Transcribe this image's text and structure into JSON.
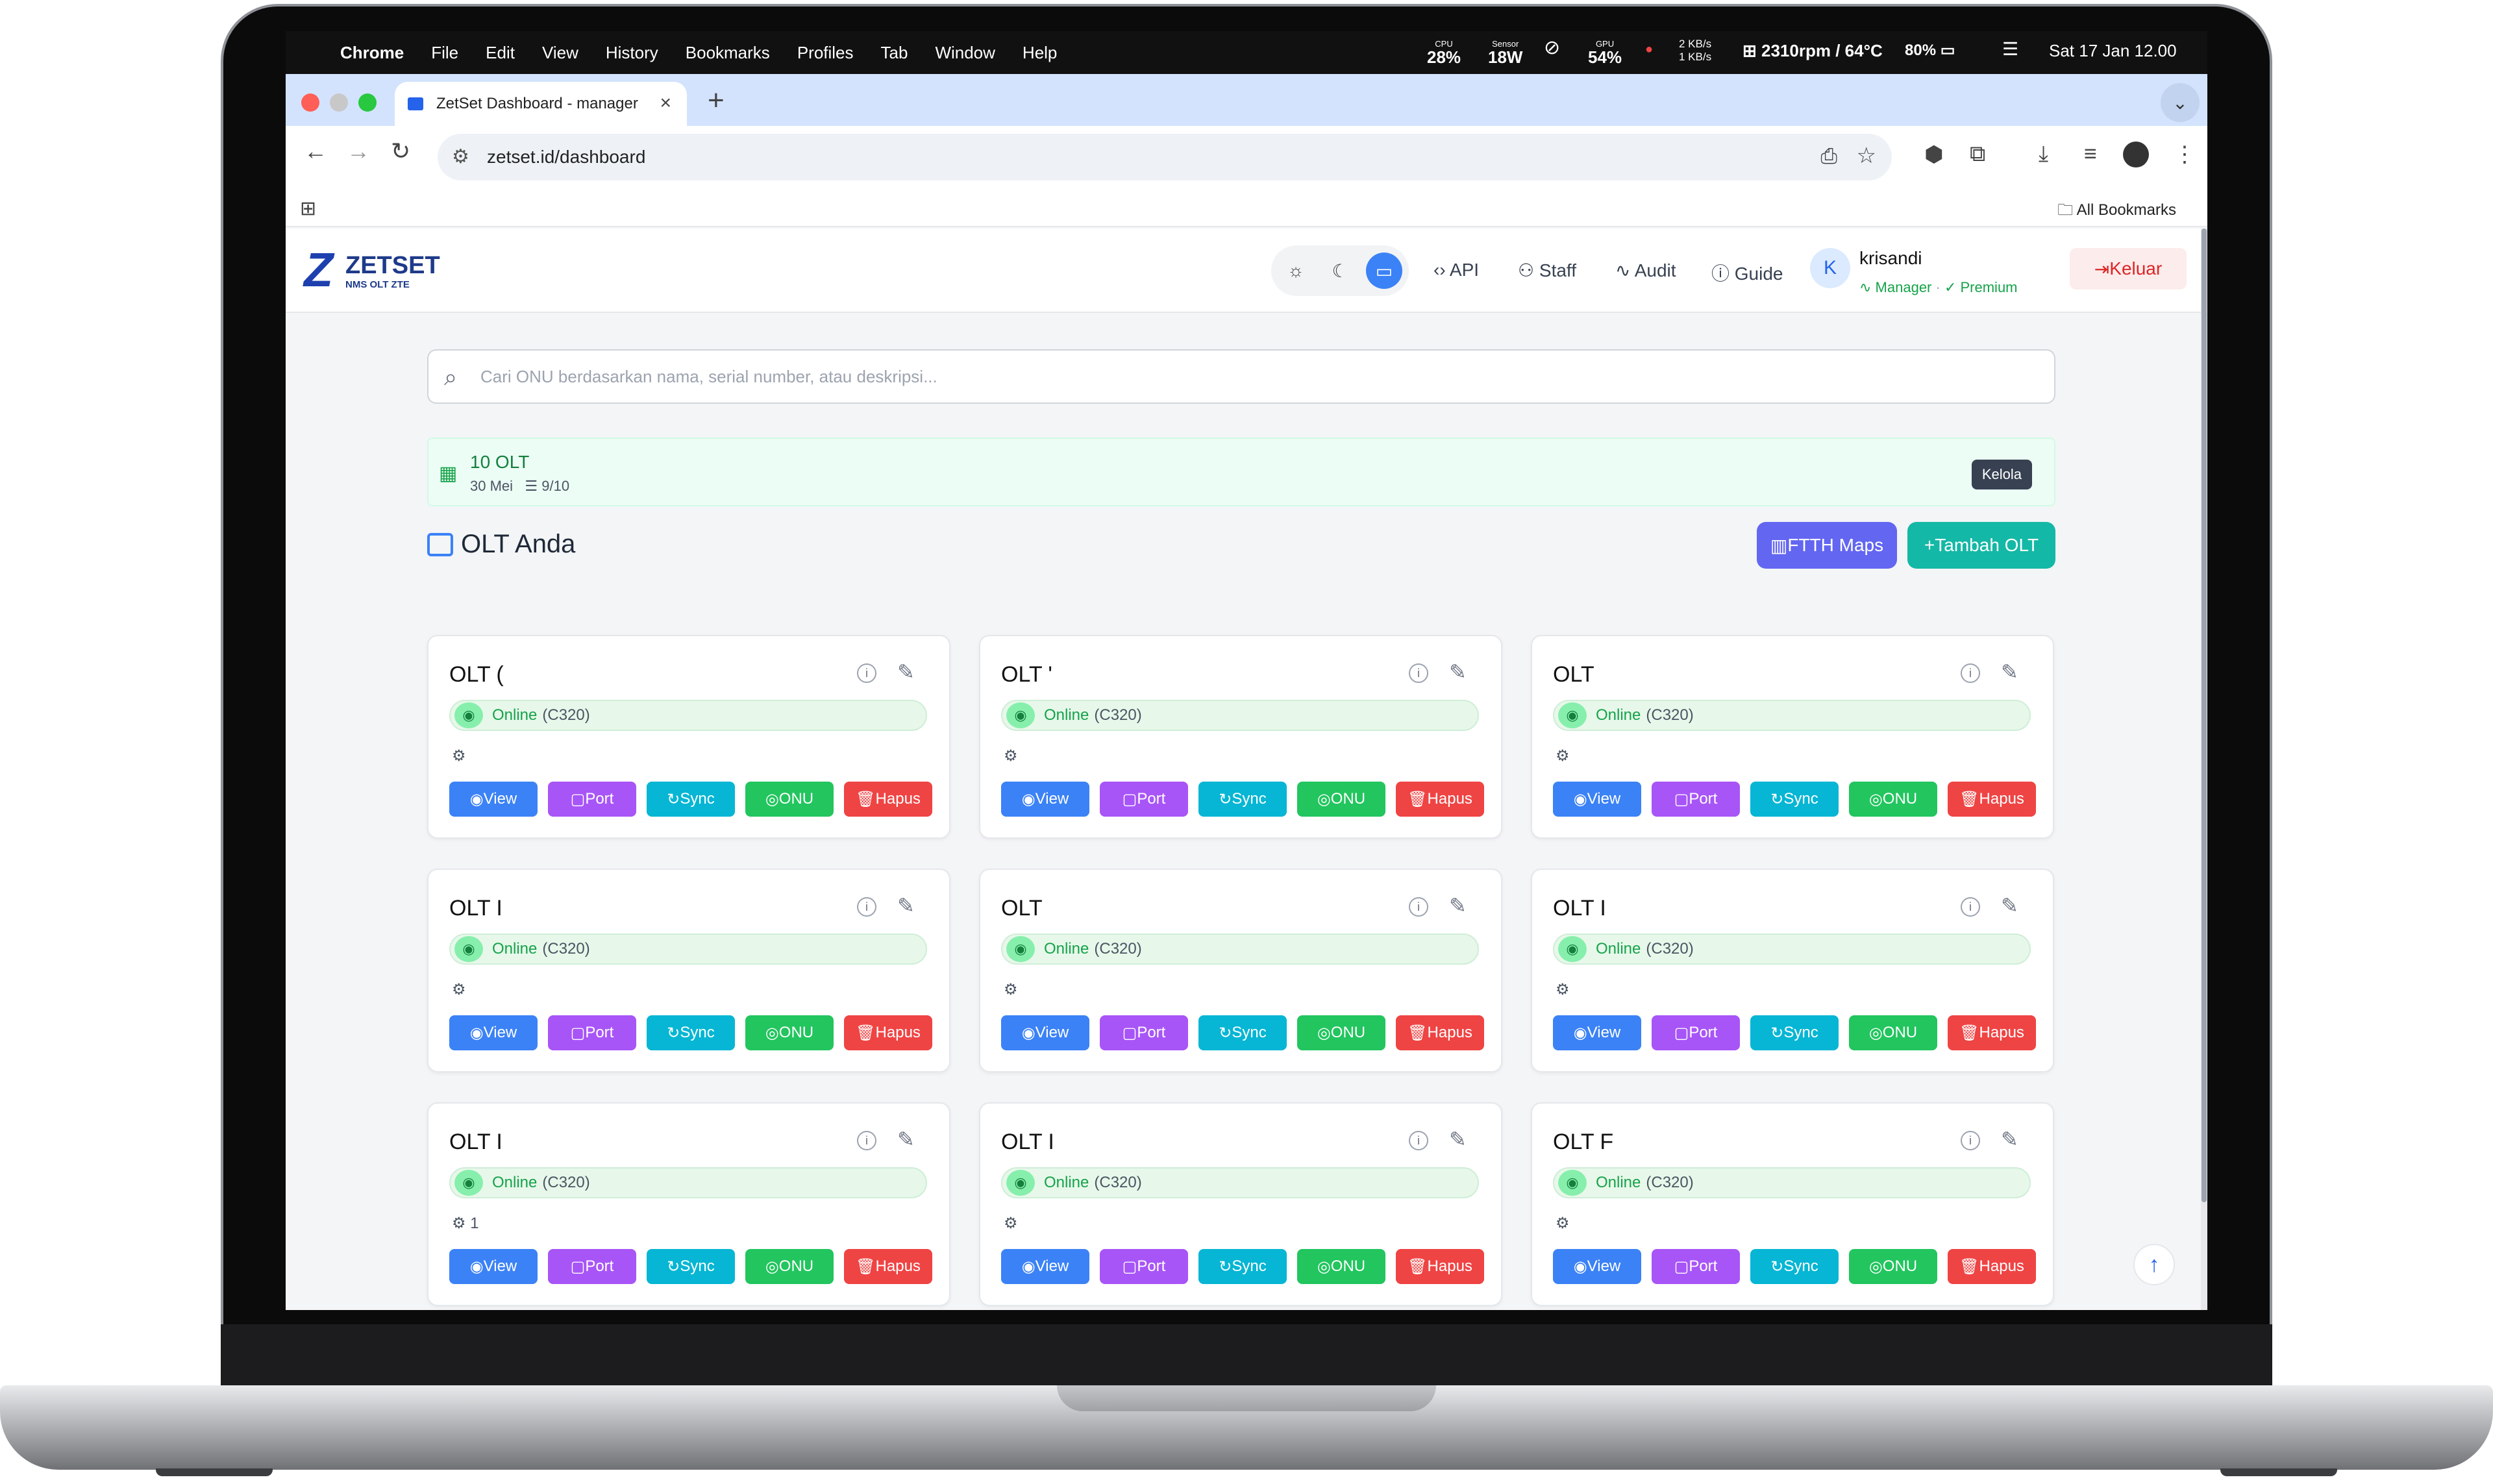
{
  "menubar": {
    "chrome": "Chrome",
    "items": [
      "File",
      "Edit",
      "View",
      "History",
      "Bookmarks",
      "Profiles",
      "Tab",
      "Window",
      "Help"
    ],
    "cpu_label": "CPU",
    "cpu": "28%",
    "sensor_label": "Sensor",
    "sensor": "18W",
    "gpu_label": "GPU",
    "gpu": "54%",
    "net_up": "2 KB/s",
    "net_down": "1 KB/s",
    "fan": "2310rpm / 64°C",
    "battery": "80%",
    "datetime": "Sat 17 Jan 12.00"
  },
  "browser": {
    "tab_title": "ZetSet Dashboard - manager",
    "url": "zetset.id/dashboard",
    "all_bookmarks": "All Bookmarks",
    "colors": {
      "close": "#ff5f57",
      "min": "#c8c8c8",
      "max": "#28c840"
    }
  },
  "app": {
    "brand": {
      "mark": "Z",
      "title": "ZETSET",
      "subtitle": "NMS OLT ZTE"
    },
    "nav": {
      "api": "API",
      "staff": "Staff",
      "audit": "Audit",
      "guide": "Guide"
    },
    "user": {
      "initial": "K",
      "name": "krisandi",
      "role": "Manager",
      "plan": "Premium",
      "logout": "Keluar"
    },
    "search_placeholder": "Cari ONU berdasarkan nama, serial number, atau deskripsi...",
    "license": {
      "title": "10 OLT",
      "date": "30 Mei",
      "usage": "9/10",
      "manage": "Kelola"
    },
    "section_title": "OLT Anda",
    "ftth_maps": "FTTH Maps",
    "add_olt": "Tambah OLT",
    "buttons": {
      "view": "View",
      "port": "Port",
      "sync": "Sync",
      "onu": "ONU",
      "hapus": "Hapus"
    },
    "cards": [
      {
        "name": "OLT (",
        "status": "Online",
        "model": "(C320)",
        "chip": ""
      },
      {
        "name": "OLT '",
        "status": "Online",
        "model": "(C320)",
        "chip": ""
      },
      {
        "name": "OLT",
        "status": "Online",
        "model": "(C320)",
        "chip": ""
      },
      {
        "name": "OLT I",
        "status": "Online",
        "model": "(C320)",
        "chip": ""
      },
      {
        "name": "OLT",
        "status": "Online",
        "model": "(C320)",
        "chip": ""
      },
      {
        "name": "OLT I",
        "status": "Online",
        "model": "(C320)",
        "chip": ""
      },
      {
        "name": "OLT I",
        "status": "Online",
        "model": "(C320)",
        "chip": "1"
      },
      {
        "name": "OLT I",
        "status": "Online",
        "model": "(C320)",
        "chip": ""
      },
      {
        "name": "OLT F",
        "status": "Online",
        "model": "(C320)",
        "chip": ""
      }
    ],
    "colors": {
      "view": "#3b82f6",
      "port": "#a855f7",
      "sync": "#06b6d4",
      "onu": "#22c55e",
      "hapus": "#ef4444",
      "ftth": "#6366f1",
      "add": "#14b8a6"
    }
  }
}
